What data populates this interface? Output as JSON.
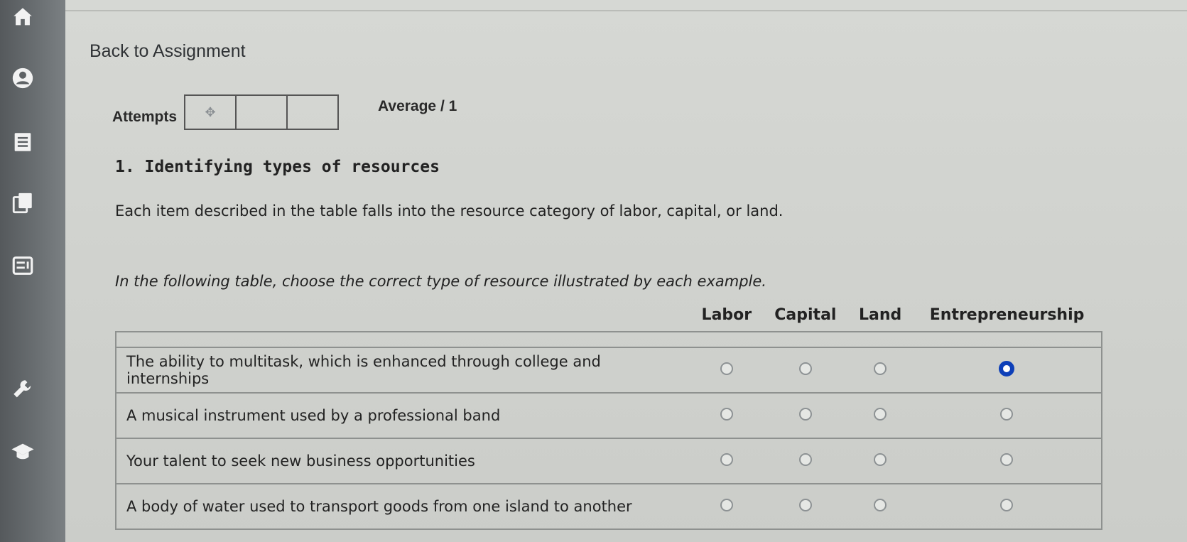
{
  "sidebar": {
    "icons": [
      "home-icon",
      "profile-icon",
      "notebook-icon",
      "book-icon",
      "gradebook-icon",
      "wrench-icon",
      "graduation-cap-icon"
    ]
  },
  "nav": {
    "back_label": "Back to Assignment"
  },
  "attempts": {
    "label": "Attempts",
    "first_box_icon": "✥",
    "average_label": "Average / 1"
  },
  "question": {
    "title": "1. Identifying types of resources",
    "description": "Each item described in the table falls into the resource category of labor, capital, or land.",
    "instruction": "In the following table, choose the correct type of resource illustrated by each example.",
    "columns": [
      "Labor",
      "Capital",
      "Land",
      "Entrepreneurship"
    ],
    "rows": [
      {
        "label": "The ability to multitask, which is enhanced through college and internships",
        "selected": "Entrepreneurship"
      },
      {
        "label": "A musical instrument used by a professional band",
        "selected": ""
      },
      {
        "label": "Your talent to seek new business opportunities",
        "selected": ""
      },
      {
        "label": "A body of water used to transport goods from one island to another",
        "selected": ""
      }
    ]
  },
  "colors": {
    "selected_radio": "#0d3fb8",
    "sidebar": "#5f6366"
  }
}
